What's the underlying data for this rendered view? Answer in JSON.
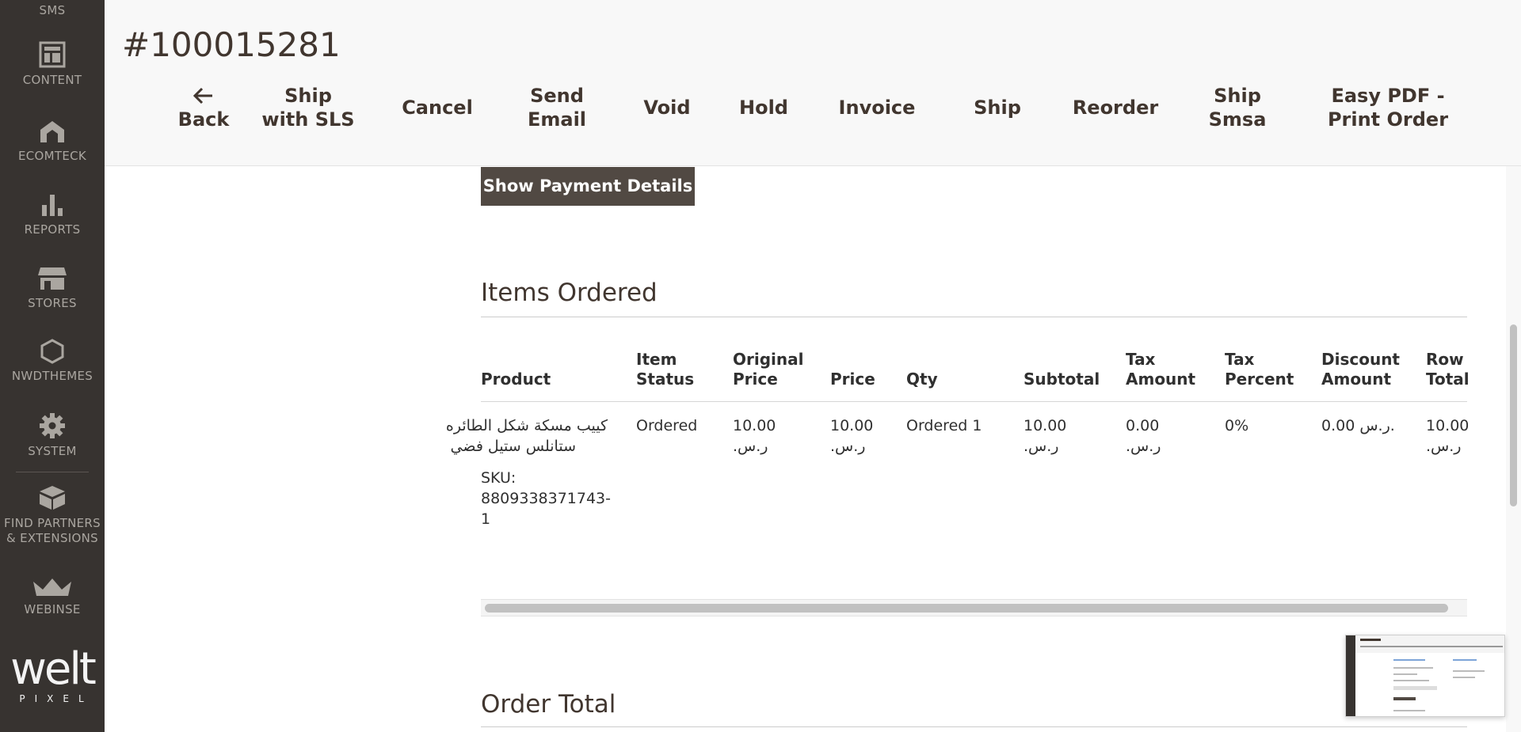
{
  "sidebar": {
    "items": [
      {
        "label": "SMS",
        "icon": "sms-icon"
      },
      {
        "label": "CONTENT",
        "icon": "content-layout-icon"
      },
      {
        "label": "ECOMTECK",
        "icon": "ecomteck-icon"
      },
      {
        "label": "REPORTS",
        "icon": "bar-chart-icon"
      },
      {
        "label": "STORES",
        "icon": "store-icon"
      },
      {
        "label": "NWDTHEMES",
        "icon": "hexagon-icon"
      },
      {
        "label": "SYSTEM",
        "icon": "gear-icon"
      },
      {
        "label": "FIND PARTNERS & EXTENSIONS",
        "label_line1": "FIND PARTNERS",
        "label_line2": "& EXTENSIONS",
        "icon": "boxes-icon"
      },
      {
        "label": "WEBINSE",
        "icon": "crown-icon"
      }
    ],
    "logo": {
      "word": "welt",
      "sub": "PIXEL"
    }
  },
  "header": {
    "order_number": "#100015281",
    "actions": [
      {
        "line1": "Back",
        "line2": "",
        "icon": "arrow-left-icon"
      },
      {
        "line1": "Ship",
        "line2": "with SLS"
      },
      {
        "line1": "Cancel",
        "line2": ""
      },
      {
        "line1": "Send",
        "line2": "Email"
      },
      {
        "line1": "Void",
        "line2": ""
      },
      {
        "line1": "Hold",
        "line2": ""
      },
      {
        "line1": "Invoice",
        "line2": ""
      },
      {
        "line1": "Ship",
        "line2": ""
      },
      {
        "line1": "Reorder",
        "line2": ""
      },
      {
        "line1": "Ship",
        "line2": "Smsa"
      },
      {
        "line1": "Easy PDF -",
        "line2": "Print Order"
      }
    ]
  },
  "payment": {
    "button_label": "Show Payment Details"
  },
  "items_ordered": {
    "title": "Items Ordered",
    "columns": [
      {
        "line1": "Product",
        "line2": ""
      },
      {
        "line1": "Item",
        "line2": "Status"
      },
      {
        "line1": "Original",
        "line2": "Price"
      },
      {
        "line1": "Price",
        "line2": ""
      },
      {
        "line1": "Qty",
        "line2": ""
      },
      {
        "line1": "Subtotal",
        "line2": ""
      },
      {
        "line1": "Tax",
        "line2": "Amount"
      },
      {
        "line1": "Tax",
        "line2": "Percent"
      },
      {
        "line1": "Discount",
        "line2": "Amount"
      },
      {
        "line1": "Row",
        "line2": "Total"
      }
    ],
    "rows": [
      {
        "product_name_line1": "كييب مسكة شكل الطائره",
        "product_name_line2": "ستانلس ستيل فضي",
        "sku_label": "SKU:",
        "sku_line1": "8809338371743-",
        "sku_line2": "1",
        "item_status": "Ordered",
        "original_price_amount": "10.00",
        "original_price_currency": "ر.س.",
        "price_amount": "10.00",
        "price_currency": "ر.س.",
        "qty": "Ordered 1",
        "subtotal_amount": "10.00",
        "subtotal_currency": "ر.س.",
        "tax_amount": "0.00",
        "tax_currency": "ر.س.",
        "tax_percent": "0%",
        "discount_amount": "0.00 ر.س.",
        "row_total_amount": "10.00",
        "row_total_currency": "ر.س."
      }
    ]
  },
  "order_total": {
    "title": "Order Total"
  },
  "colors": {
    "sidebar_bg": "#373330",
    "header_bg": "#f8f8f8",
    "primary_button_bg": "#514943",
    "text": "#41362f"
  }
}
